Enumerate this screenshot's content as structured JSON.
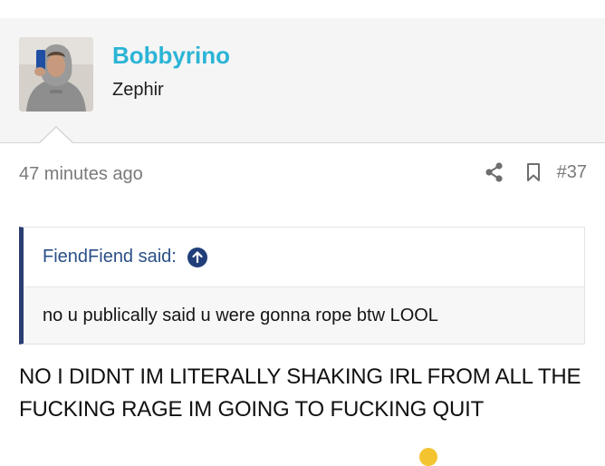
{
  "post": {
    "user": {
      "username": "Bobbyrino",
      "user_title": "Zephir",
      "avatar_icon": "user-avatar-photo"
    },
    "time": "47 minutes ago",
    "number": "#37",
    "actions": {
      "share_icon": "share-icon",
      "bookmark_icon": "bookmark-icon"
    },
    "quote": {
      "author_label": "FiendFiend said:",
      "jump_icon": "arrow-up-circle-icon",
      "text": "no u publically said u were gonna rope btw LOOL"
    },
    "message": "NO I DIDNT IM LITERALLY SHAKING IRL FROM ALL THE FUCKING RAGE IM GOING TO FUCKING QUIT"
  },
  "colors": {
    "username": "#2bb4d6",
    "quote_border": "#2a3d73",
    "quote_author": "#2a4f86",
    "meta_text": "#7a7a7a"
  }
}
